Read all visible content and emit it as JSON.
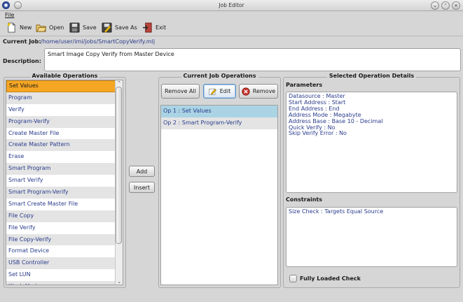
{
  "window": {
    "title": "Job Editor"
  },
  "menu": {
    "file_label": "File"
  },
  "toolbar": {
    "new_label": "New",
    "open_label": "Open",
    "save_label": "Save",
    "save_as_label": "Save As",
    "exit_label": "Exit"
  },
  "current_job": {
    "label": "Current Job:",
    "path": "/home/user/imi/jobs/SmartCopyVerify.mlj"
  },
  "description": {
    "label": "Description:",
    "value": "Smart Image Copy Verify from Master Device"
  },
  "available_operations": {
    "title": "Available Operations",
    "selected_index": 0,
    "items": [
      "Set Values",
      "Program",
      "Verify",
      "Program-Verify",
      "Create Master File",
      "Create Master Pattern",
      "Erase",
      "Smart Program",
      "Smart Verify",
      "Smart Program-Verify",
      "Smart Create Master File",
      "File Copy",
      "File Verify",
      "File Copy-Verify",
      "Format Device",
      "USB Controller",
      "Set LUN",
      "Kiosk Mode"
    ]
  },
  "middle_buttons": {
    "add_label": "Add",
    "insert_label": "Insert"
  },
  "current_job_operations": {
    "title": "Current Job Operations",
    "remove_all_label": "Remove All",
    "edit_label": "Edit",
    "remove_label": "Remove",
    "selected_index": 0,
    "items": [
      "Op 1 : Set Values",
      "Op 2 : Smart Program-Verify"
    ]
  },
  "selected_operation_details": {
    "title": "Selected Operation Details",
    "parameters_label": "Parameters",
    "parameters": [
      "Datasource : Master",
      "Start Address : Start",
      "End Address : End",
      "Address Mode : Megabyte",
      "Address Base : Base 10 - Decimal",
      "Quick Verify : No",
      "Skip Verify Error : No"
    ],
    "constraints_label": "Constraints",
    "constraints": [
      "Size Check : Targets Equal Source"
    ],
    "fully_loaded_check_label": "Fully Loaded Check",
    "fully_loaded_check_checked": false
  },
  "colors": {
    "accent_selection": "#f5a623",
    "job_selection": "#aad4e4",
    "link_text": "#2a3c8c"
  }
}
